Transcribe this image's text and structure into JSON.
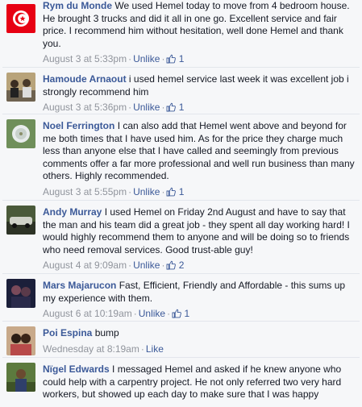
{
  "comments": [
    {
      "author": "Rym du Monde",
      "text": "We used Hemel today to move from 4 bedroom house. He brought 3 trucks and did it all in one go. Excellent service and fair price. I recommend him without hesitation, well done Hemel and thank you.",
      "time": "August 3 at 5:33pm",
      "action": "Unlike",
      "likes": "1",
      "avatar": "tunisia-flag"
    },
    {
      "author": "Hamoude Arnaout",
      "text": "i used hemel service last week it was excellent job i strongly recommend him",
      "time": "August 3 at 5:36pm",
      "action": "Unlike",
      "likes": "1",
      "avatar": "group-photo"
    },
    {
      "author": "Noel Ferrington",
      "text": "I can also add that Hemel went above and beyond for me both times that I have used him. As for the price they charge much less than anyone else that I have called and seemingly from previous comments offer a far more professional and well run business than many others. Highly recommended.",
      "time": "August 3 at 5:55pm",
      "action": "Unlike",
      "likes": "1",
      "avatar": "dandelion"
    },
    {
      "author": "Andy Murray",
      "text": "I used Hemel on Friday 2nd August and have to say that the man and his team did a great job - they spent all day working hard! I would highly recommend them to anyone and will be doing so to friends who need removal services. Good trust-able guy!",
      "time": "August 4 at 9:09am",
      "action": "Unlike",
      "likes": "2",
      "avatar": "car-photo"
    },
    {
      "author": "Mars Majarucon",
      "text": "Fast, Efficient, Friendly and Affordable - this sums up my experience with them.",
      "time": "August 6 at 10:19am",
      "action": "Unlike",
      "likes": "1",
      "avatar": "night-photo"
    },
    {
      "author": "Poi Espina",
      "text": "bump",
      "time": "Wednesday at 8:19am",
      "action": "Like",
      "likes": "",
      "avatar": "couple-photo"
    },
    {
      "author": "Nïgel Edwards",
      "text": "I messaged Hemel and asked if he knew anyone who could help with a carpentry project. He not only referred two very hard workers, but showed up each day to make sure that I was happy",
      "time": "",
      "action": "",
      "likes": "",
      "avatar": "outdoor-photo"
    }
  ]
}
